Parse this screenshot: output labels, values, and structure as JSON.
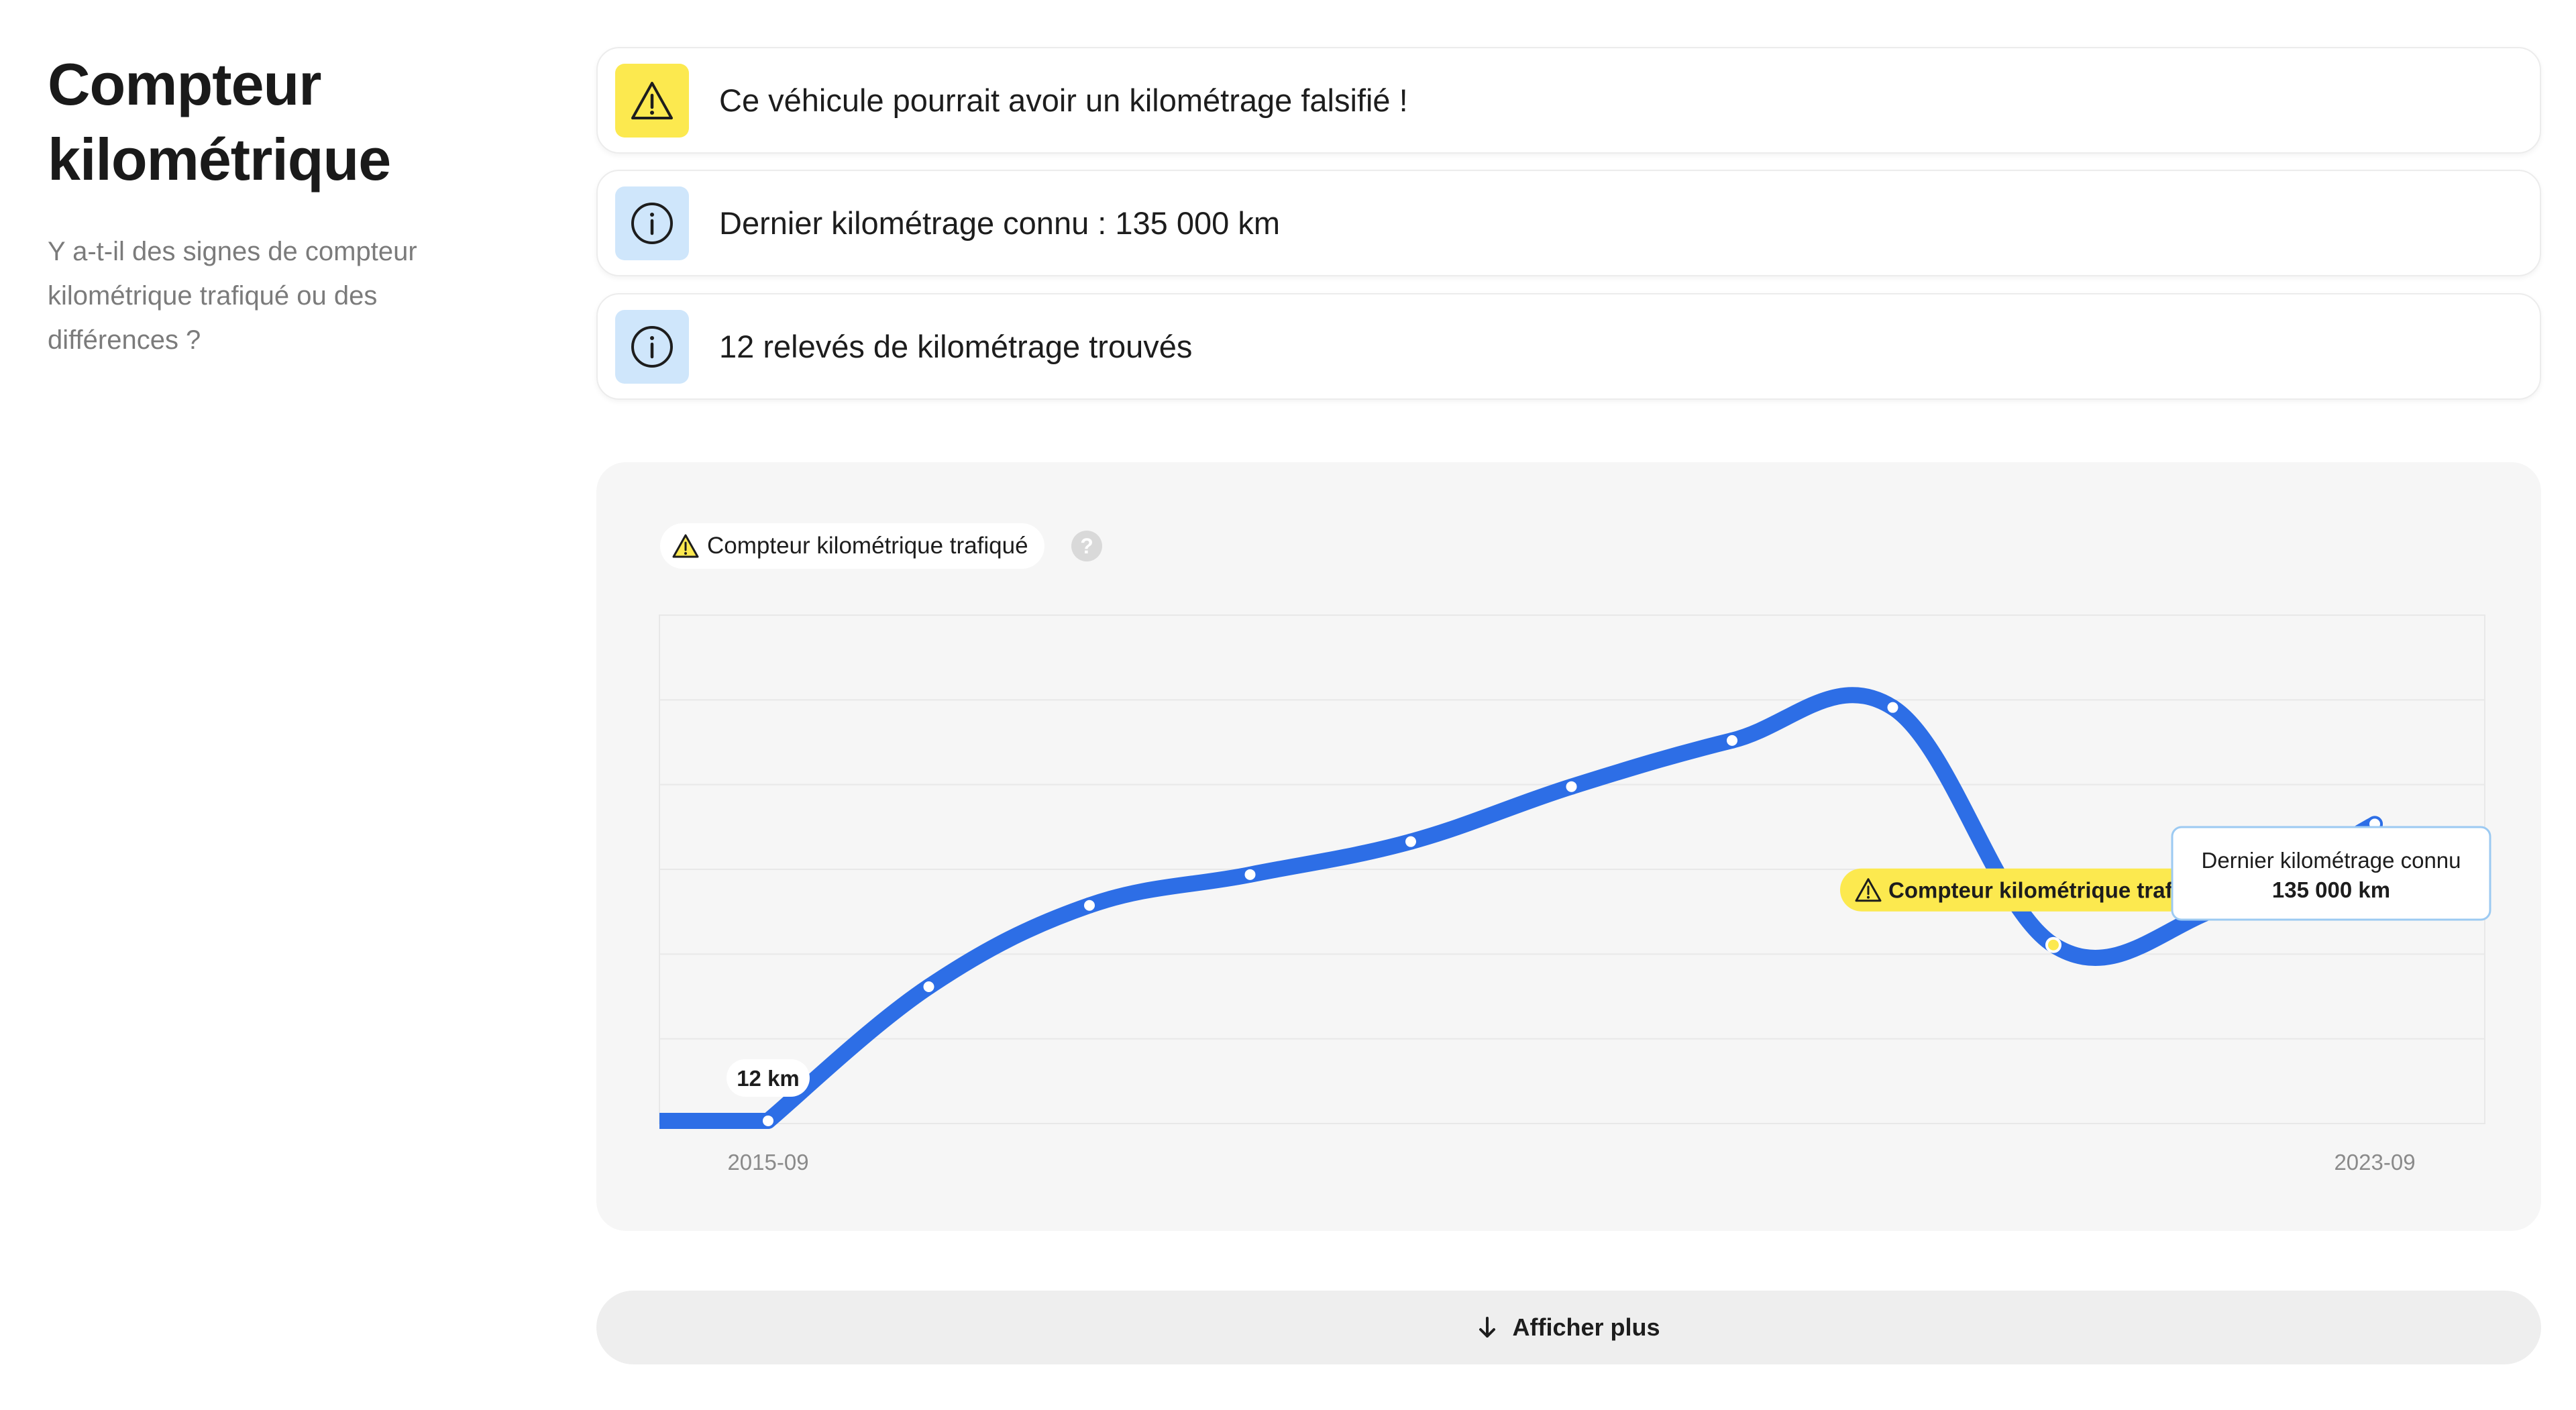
{
  "section": {
    "title": "Compteur kilométrique",
    "subtitle": "Y a-t-il des signes de compteur kilométrique trafiqué ou des différences ?"
  },
  "alerts": [
    {
      "type": "warning",
      "icon": "warning-triangle-icon",
      "text": "Ce véhicule pourrait avoir un kilométrage falsifié !"
    },
    {
      "type": "info",
      "icon": "info-circle-icon",
      "text": "Dernier kilométrage connu : 135 000 km"
    },
    {
      "type": "info",
      "icon": "info-circle-icon",
      "text": "12 relevés de kilométrage trouvés"
    }
  ],
  "chart": {
    "legend_chip": "Compteur kilométrique trafiqué",
    "help": "?",
    "first_point_label": "12 km",
    "anomaly_label": "Compteur kilométrique trafiqué",
    "tooltip_title": "Dernier kilométrage connu",
    "tooltip_value": "135 000 km"
  },
  "chart_data": {
    "type": "line",
    "x": [
      "2015-09",
      "2016-06",
      "2017-04",
      "2018-01",
      "2018-11",
      "2019-08",
      "2020-06",
      "2021-03",
      "2021-12",
      "2022-10",
      "2023-09"
    ],
    "values": [
      12,
      61000,
      98000,
      112000,
      127000,
      152000,
      173000,
      188000,
      80000,
      96000,
      135000
    ],
    "series": [
      {
        "values": [
          12,
          61000,
          98000,
          112000,
          127000,
          152000,
          173000,
          188000,
          80000,
          96000,
          135000
        ]
      }
    ],
    "xtick_labels": [
      "2015-09",
      "2023-09"
    ],
    "anomaly_index": 8,
    "last_index": 10,
    "grid": true,
    "colors": {
      "line": "#2d6ee6",
      "anomaly": "#fce94f",
      "warning": "#fce94f",
      "info": "#cfe6fb"
    }
  },
  "footer": {
    "button_label": "Afficher plus",
    "button_icon": "arrow-down-icon"
  }
}
